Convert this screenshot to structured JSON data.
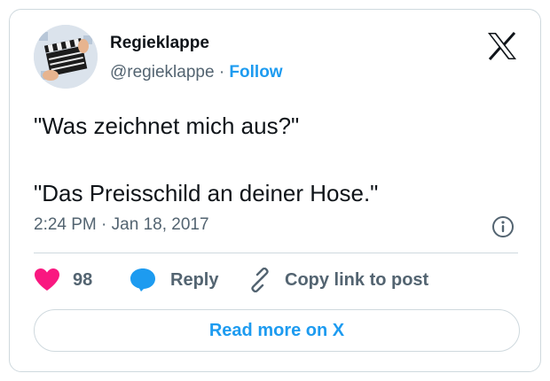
{
  "author": {
    "name": "Regieklappe",
    "handle": "@regieklappe",
    "separator": "·",
    "follow_label": "Follow",
    "avatar_icon": "clapperboard-avatar"
  },
  "brand_icon": "x-logo-icon",
  "tweet": {
    "lines": [
      "\"Was zeichnet mich aus?\"",
      "\"Das Preisschild an deiner Hose.\""
    ]
  },
  "timestamp": {
    "time": "2:24 PM",
    "separator": "·",
    "date": "Jan 18, 2017"
  },
  "actions": {
    "like_count": "98",
    "reply_label": "Reply",
    "copy_label": "Copy link to post"
  },
  "read_more_label": "Read more on X",
  "colors": {
    "accent": "#1d9bf0",
    "like": "#f91880",
    "text": "#0f1419",
    "muted": "#536471",
    "border": "#cfd9de"
  }
}
